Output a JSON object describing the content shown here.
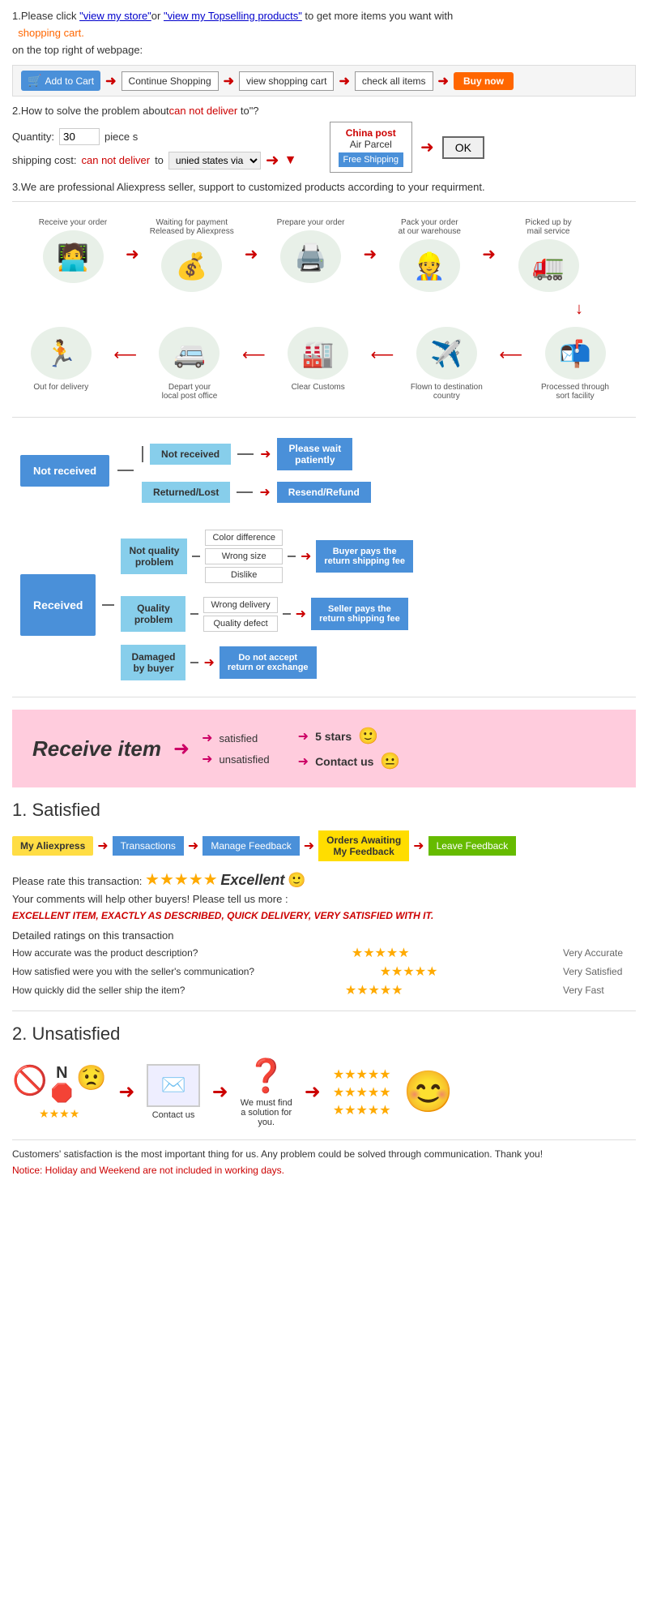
{
  "section1": {
    "text1": "1.Please click ",
    "link1": "\"view my store\"",
    "text2": "or ",
    "link2": "\"view my Topselling products\"",
    "text3": " to get more items you want with",
    "link3": "shopping cart.",
    "text4": "on the top right of webpage:",
    "cart_label": "Add to Cart",
    "continue_label": "Continue Shopping",
    "view_cart_label": "view shopping cart",
    "check_label": "check all items",
    "buy_label": "Buy now"
  },
  "section2": {
    "title": "2.How to solve the problem about",
    "red_text": "can not deliver",
    "title_end": " to\"?",
    "qty_label": "Quantity:",
    "qty_value": "30",
    "qty_unit": "piece s",
    "shipping_label": "shipping cost:",
    "shipping_red": "can not deliver",
    "shipping_text": " to",
    "shipping_select": "unied states via",
    "china_post": "China post",
    "air_parcel": "Air Parcel",
    "free_shipping": "Free Shipping",
    "ok_label": "OK"
  },
  "section3": {
    "text": "3.We are professional Aliexpress seller, support to customized products according to your requirment."
  },
  "order_flow": {
    "top_steps": [
      {
        "label": "Receive your order",
        "icon": "🧑‍💻"
      },
      {
        "label": "Waiting for payment\nReleased by Aliexpress",
        "icon": "💰"
      },
      {
        "label": "Prepare your order",
        "icon": "🖨️"
      },
      {
        "label": "Pack your order\nat our warehouse",
        "icon": "👷"
      },
      {
        "label": "Picked up by\nmail service",
        "icon": "🚛"
      }
    ],
    "bottom_steps": [
      {
        "label": "Out for delivery",
        "icon": "🏃"
      },
      {
        "label": "Depart your\nlocal post office",
        "icon": "🚐"
      },
      {
        "label": "Clear Customs",
        "icon": "🏭"
      },
      {
        "label": "Flown to destination\ncountry",
        "icon": "✈️"
      },
      {
        "label": "Processed through\nsort facility",
        "icon": "📦"
      }
    ]
  },
  "not_received_chart": {
    "main_label": "Not received",
    "sub1_label": "Not received",
    "sub1_result": "Please wait\npatiently",
    "sub2_label": "Returned/Lost",
    "sub2_result": "Resend/Refund"
  },
  "received_chart": {
    "main_label": "Received",
    "branch1": {
      "label": "Not quality\nproblem",
      "items": [
        "Color difference",
        "Wrong size",
        "Dislike"
      ],
      "result": "Buyer pays the\nreturn shipping fee"
    },
    "branch2": {
      "label": "Quality\nproblem",
      "items": [
        "Wrong delivery",
        "Quality defect"
      ],
      "result": "Seller pays the\nreturn shipping fee"
    },
    "branch3": {
      "label": "Damaged\nby buyer",
      "result": "Do not accept\nreturn or exchange"
    }
  },
  "receive_item": {
    "title": "Receive item",
    "outcomes": [
      "satisfied",
      "unsatisfied"
    ],
    "results": [
      "5 stars",
      "Contact us"
    ],
    "emoji1": "🙂",
    "emoji2": "😐"
  },
  "satisfied": {
    "number": "1.",
    "title": "Satisfied",
    "steps": [
      "My Aliexpress",
      "Transactions",
      "Manage Feedback",
      "Orders Awaiting\nMy Feedback",
      "Leave Feedback"
    ],
    "rate_text": "Please rate this transaction:",
    "stars": "★★★★★",
    "excellent": "Excellent",
    "smiley": "🙂",
    "comment_text": "Your comments will help other buyers! Please tell us more :",
    "italic_text": "EXCELLENT ITEM, EXACTLY AS DESCRIBED, QUICK DELIVERY, VERY SATISFIED WITH IT.",
    "detailed_label": "Detailed ratings on this transaction",
    "ratings": [
      {
        "label": "How accurate was the product description?",
        "stars": "★★★★★",
        "value": "Very Accurate"
      },
      {
        "label": "How satisfied were you with the seller's communication?",
        "stars": "★★★★★",
        "value": "Very Satisfied"
      },
      {
        "label": "How quickly did the seller ship the item?",
        "stars": "★★★★★",
        "value": "Very Fast"
      }
    ]
  },
  "unsatisfied": {
    "number": "2.",
    "title": "Unsatisfied",
    "flow": [
      {
        "type": "stars-no",
        "icon": "🚫",
        "stars": "★★★★"
      },
      {
        "type": "email",
        "icon": "✉️",
        "label": "Contact us"
      },
      {
        "type": "question",
        "icon": "❓",
        "label": "We must find\na solution for\nyou."
      },
      {
        "type": "stars",
        "lines": [
          "☆☆☆☆☆",
          "☆☆☆☆☆",
          "☆☆☆☆☆"
        ]
      },
      {
        "type": "smiley",
        "icon": "😊"
      }
    ]
  },
  "footer": {
    "text1": "Customers' satisfaction is the most important thing for us. Any problem could be solved through communication. Thank you!",
    "notice": "Notice: Holiday and Weekend are not included in working days."
  }
}
